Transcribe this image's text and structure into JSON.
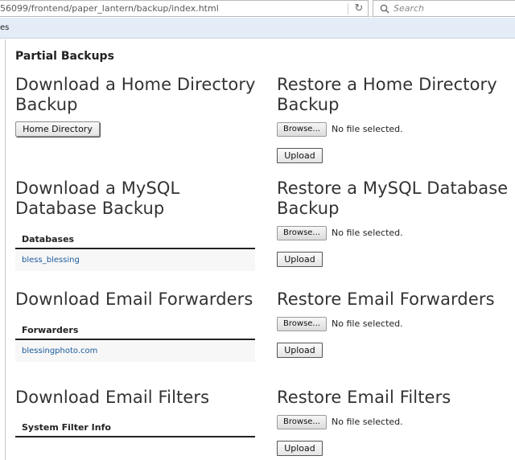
{
  "browser": {
    "url": "56099/frontend/paper_lantern/backup/index.html",
    "search_placeholder": "Search",
    "bookmark_fragment": "es"
  },
  "page": {
    "section_title": "Partial Backups",
    "home": {
      "download_title_1": "Download a Home Directory",
      "download_title_2": "Backup",
      "download_button": "Home Directory",
      "restore_title_1": "Restore a Home Directory",
      "restore_title_2": "Backup"
    },
    "mysql": {
      "download_title_1": "Download a MySQL",
      "download_title_2": "Database Backup",
      "table_header": "Databases",
      "rows": [
        "bless_blessing"
      ],
      "restore_title_1": "Restore a MySQL Database",
      "restore_title_2": "Backup"
    },
    "forwarders": {
      "download_title": "Download Email Forwarders",
      "table_header": "Forwarders",
      "rows": [
        "blessingphoto.com"
      ],
      "restore_title": "Restore Email Forwarders"
    },
    "filters": {
      "download_title": "Download Email Filters",
      "table_header": "System Filter Info",
      "restore_title": "Restore Email Filters"
    },
    "file_input": {
      "browse_label": "Browse...",
      "no_file_label": "No file selected."
    },
    "upload_label": "Upload"
  }
}
